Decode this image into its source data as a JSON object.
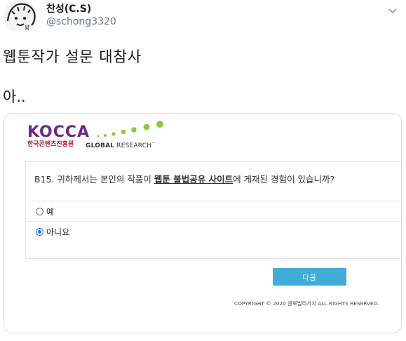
{
  "tweet": {
    "author_name": "찬성(C.S)",
    "author_handle": "@schong3320",
    "line1": "웹툰작가 설문 대참사",
    "line2": "아.."
  },
  "card": {
    "logo": "KOCCA",
    "logo_sub": "한국콘텐츠진흥원",
    "partner_bold": "GLOBAL",
    "partner_rest": " RESEARCH",
    "partner_mark": "™",
    "question_prefix": "B15. 귀하께서는 본인의 작품이 ",
    "question_emphasis": "웹툰 불법공유 사이트",
    "question_suffix": "에 게재된 경험이 있습니까?",
    "options": [
      {
        "label": "예",
        "checked": false
      },
      {
        "label": "아니요",
        "checked": true
      }
    ],
    "next_label": "다음",
    "copyright": "COPYRIGHT © 2020 글로벌리서치 ALL RIGHTS RESERVED."
  },
  "colors": {
    "kocca_purple": "#6b2a86",
    "kocca_red": "#b01d3e",
    "dot_green": "#8dc63f",
    "button_blue": "#3eaed6",
    "radio_blue": "#1a73e8"
  }
}
